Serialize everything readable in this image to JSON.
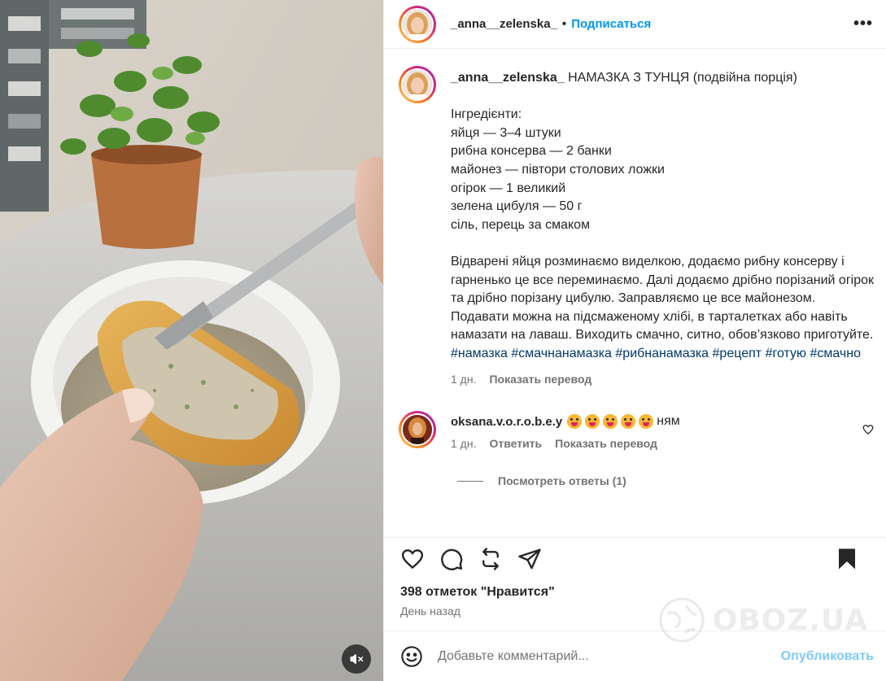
{
  "header": {
    "username": "_anna__zelenska_",
    "separator": "•",
    "follow_label": "Подписаться",
    "more_label": "•••"
  },
  "post": {
    "username": "_anna__zelenska_",
    "title": "НАМАЗКА З ТУНЦЯ (подвійна порція)",
    "lines": [
      "Інгредієнти:",
      "яйця — 3–4 штуки",
      "рибна консерва — 2 банки",
      "майонез — півтори столових ложки",
      "огірок — 1 великий",
      "зелена цибуля — 50 г",
      "сіль, перець за смаком"
    ],
    "paragraph1": "Відварені яйця розминаємо виделкою, додаємо рибну консерву і гарненько це все перeминаємо. Далі додаємо дрібно порізаний огірок та дрібно порізану цибулю. Заправляємо це все майонезом.",
    "paragraph2": "Подавати можна на підсмаженому хлібі, в тарталетках або навіть намазати на лаваш. Виходить смачно, ситно, обов’язково приготуйте.",
    "hashtags": [
      "#намазка",
      "#смачнанамазка",
      "#рибнанамазка",
      "#рецепт",
      "#готую",
      "#смачно"
    ],
    "time": "1 дн.",
    "translate_label": "Показать перевод"
  },
  "comment": {
    "username": "oksana.v.o.r.o.b.e.y",
    "text": "ням",
    "time": "1 дн.",
    "reply_label": "Ответить",
    "translate_label": "Показать перевод",
    "view_replies": "Посмотреть ответы (1)"
  },
  "actions": {
    "likes": "398 отметок \"Нравится\"",
    "time_ago": "День назад"
  },
  "add_comment": {
    "placeholder": "Добавьте комментарий...",
    "publish_label": "Опубликовать"
  },
  "watermark": {
    "text": "OBOZ.UA"
  },
  "colors": {
    "link": "#0095f6",
    "hashtag": "#00376b",
    "muted": "#737373",
    "text": "#262626"
  },
  "icons": [
    "mute-icon",
    "more-icon",
    "heart-icon",
    "comment-icon",
    "repost-icon",
    "share-icon",
    "bookmark-icon",
    "emoji-icon"
  ]
}
